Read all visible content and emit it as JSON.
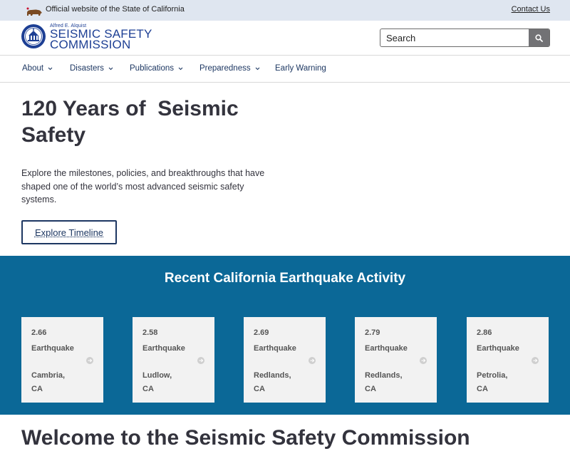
{
  "utility": {
    "official_text": "Official website of the State of California",
    "contact_label": "Contact Us"
  },
  "header": {
    "logo_small": "Alfred E. Alquist",
    "logo_line1": "SEISMIC SAFETY",
    "logo_line2": "COMMISSION",
    "search_placeholder": "Search"
  },
  "nav": {
    "items": [
      {
        "label": "About",
        "has_dropdown": true
      },
      {
        "label": "Disasters",
        "has_dropdown": true
      },
      {
        "label": "Publications",
        "has_dropdown": true
      },
      {
        "label": "Preparedness",
        "has_dropdown": true
      },
      {
        "label": "Early Warning",
        "has_dropdown": false
      }
    ]
  },
  "hero": {
    "title": "120 Years of  Seismic Safety",
    "description": "Explore the milestones, policies, and breakthroughs that have shaped one of the world’s most advanced seismic safety systems.",
    "button_label": "Explore Timeline"
  },
  "quake": {
    "title": "Recent California Earthquake Activity",
    "cards": [
      {
        "magnitude": "2.66",
        "type": "Earthquake",
        "location": "Cambria, CA"
      },
      {
        "magnitude": "2.58",
        "type": "Earthquake",
        "location": "Ludlow, CA"
      },
      {
        "magnitude": "2.69",
        "type": "Earthquake",
        "location": "Redlands, CA"
      },
      {
        "magnitude": "2.79",
        "type": "Earthquake",
        "location": "Redlands, CA"
      },
      {
        "magnitude": "2.86",
        "type": "Earthquake",
        "location": "Petrolia, CA"
      }
    ]
  },
  "welcome": {
    "title": "Welcome to the Seismic Safety Commission"
  },
  "colors": {
    "utility_bg": "#dfe6f0",
    "brand_blue": "#1d3f94",
    "nav_text": "#1d3762",
    "quake_bg": "#0b6897",
    "card_bg": "#f2f2f2"
  },
  "icons": {
    "utility": "california-bear-icon",
    "logo": "commission-seal-icon",
    "search": "search-icon",
    "dropdown": "chevron-down-icon",
    "card_link": "circle-arrow-right-icon"
  }
}
